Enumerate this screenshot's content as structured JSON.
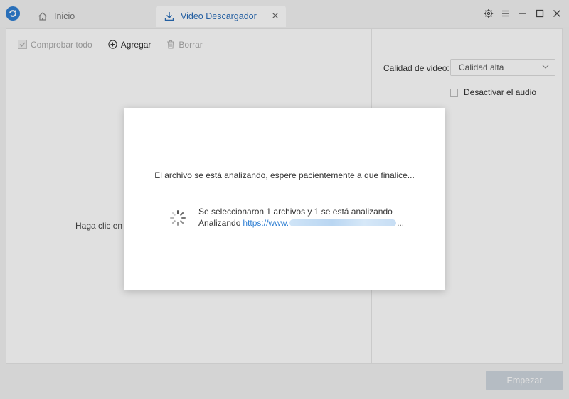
{
  "tabs": [
    {
      "label": "Inicio",
      "icon": "home-icon",
      "active": false
    },
    {
      "label": "Video Descargador",
      "icon": "download-icon",
      "active": true
    }
  ],
  "window_controls": [
    "gear-icon",
    "menu-icon",
    "minimize-icon",
    "maximize-icon",
    "close-icon"
  ],
  "toolbar": {
    "check_all_label": "Comprobar todo",
    "add_label": "Agregar",
    "delete_label": "Borrar"
  },
  "list": {
    "hint_text": "Haga clic en"
  },
  "settings": {
    "quality_label": "Calidad de video:",
    "quality_value": "Calidad alta",
    "disable_audio_label": "Desactivar el audio"
  },
  "start_label": "Empezar",
  "modal": {
    "message": "El archivo se está analizando, espere pacientemente a que finalice...",
    "status_line": "Se seleccionaron 1 archivos y 1 se está analizando",
    "analyzing_prefix": "Analizando",
    "url_visible": "https://www.",
    "url_suffix": "..."
  },
  "colors": {
    "accent": "#2f7fd3",
    "start_disabled": "#cfd6de"
  }
}
